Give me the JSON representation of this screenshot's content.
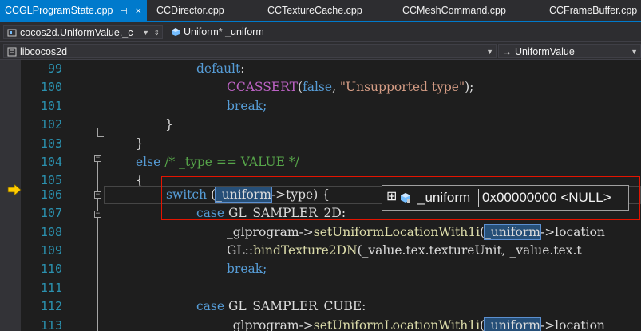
{
  "tabs": [
    {
      "label": "CCGLProgramState.cpp",
      "active": true
    },
    {
      "label": "CCDirector.cpp"
    },
    {
      "label": "CCTextureCache.cpp"
    },
    {
      "label": "CCMeshCommand.cpp"
    },
    {
      "label": "CCFrameBuffer.cpp"
    }
  ],
  "tab_icons": {
    "pin": "⊣",
    "close": "✕"
  },
  "nav": {
    "scope": "cocos2d.UniformValue._c",
    "member": "Uniform* _uniform",
    "project": "libcocos2d",
    "function": "→ UniformValue"
  },
  "lines": [
    {
      "n": "99"
    },
    {
      "n": "100"
    },
    {
      "n": "101"
    },
    {
      "n": "102"
    },
    {
      "n": "103"
    },
    {
      "n": "104"
    },
    {
      "n": "105"
    },
    {
      "n": "106"
    },
    {
      "n": "107"
    },
    {
      "n": "108"
    },
    {
      "n": "109"
    },
    {
      "n": "110"
    },
    {
      "n": "111"
    },
    {
      "n": "112"
    },
    {
      "n": "113"
    }
  ],
  "code": {
    "l99_default": "default",
    "l99_colon": ":",
    "l100_macro": "CCASSERT",
    "l100_a": "(",
    "l100_false": "false",
    "l100_b": ", ",
    "l100_str": "\"Unsupported type\"",
    "l100_c": ");",
    "l101": "break;",
    "l102": "}",
    "l103": "}",
    "l104_else": "else",
    "l104_cm": " /* _type == VALUE */",
    "l104_ws": " ",
    "l105": "{",
    "l106_switch": "switch",
    "l106_a": " (",
    "l106_uni": "_uniform",
    "l106_b": "->type) {",
    "l107_case": "case",
    "l107_rest": " GL_SAMPLER_2D:",
    "l108_a": "_glprogram->",
    "l108_fn": "setUniformLocationWith1i",
    "l108_b": "(",
    "l108_uni": "_uniform",
    "l108_c": "->location",
    "l109_a": "GL::",
    "l109_fn": "bindTexture2DN",
    "l109_b": "(_value.tex.textureUnit, _value.tex.t",
    "l110": "break;",
    "l112_case": "case",
    "l112_rest": " GL_SAMPLER_CUBE:",
    "l113_a": "_glprogram->",
    "l113_fn": "setUniformLocationWith1i",
    "l113_b": "(",
    "l113_uni": "_uniform",
    "l113_c": "->location"
  },
  "datatip": {
    "expand": "⊞",
    "name": "_uniform",
    "value": "0x00000000 <NULL>"
  },
  "colors": {
    "accent": "#007acc",
    "keyword": "#569cd6",
    "line_number": "#2b91af",
    "string": "#d69d85",
    "comment": "#57a64a",
    "highlight_border": "#e51400"
  }
}
